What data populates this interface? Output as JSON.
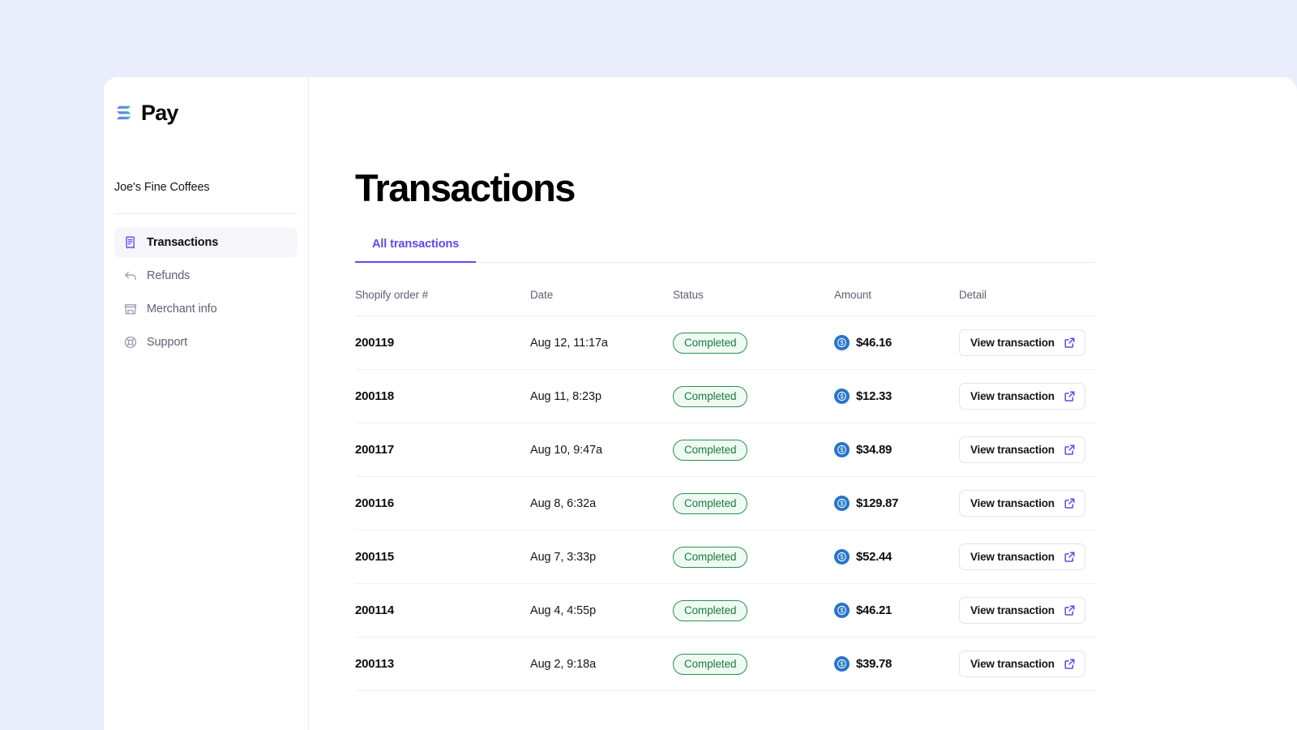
{
  "brand": {
    "logo_icon": "solana-bars-logo-icon",
    "name": "Pay",
    "gradient_from": "#19e0a8",
    "gradient_to": "#9945ff"
  },
  "sidebar": {
    "merchant_name": "Joe's Fine Coffees",
    "items": [
      {
        "label": "Transactions",
        "icon": "receipt-icon",
        "active": true
      },
      {
        "label": "Refunds",
        "icon": "arrow-return-icon",
        "active": false
      },
      {
        "label": "Merchant info",
        "icon": "storefront-icon",
        "active": false
      },
      {
        "label": "Support",
        "icon": "lifebuoy-icon",
        "active": false
      }
    ]
  },
  "main": {
    "page_title": "Transactions",
    "tabs": [
      {
        "label": "All transactions",
        "active": true
      }
    ],
    "table": {
      "columns": [
        "Shopify order #",
        "Date",
        "Status",
        "Amount",
        "Detail"
      ],
      "detail_button_label": "View transaction",
      "detail_button_icon": "external-link-icon",
      "currency_icon": "usdc-coin-icon",
      "rows": [
        {
          "order": "200119",
          "date": "Aug 12, 11:17a",
          "status": "Completed",
          "amount": "$46.16"
        },
        {
          "order": "200118",
          "date": "Aug 11, 8:23p",
          "status": "Completed",
          "amount": "$12.33"
        },
        {
          "order": "200117",
          "date": "Aug 10, 9:47a",
          "status": "Completed",
          "amount": "$34.89"
        },
        {
          "order": "200116",
          "date": "Aug 8, 6:32a",
          "status": "Completed",
          "amount": "$129.87"
        },
        {
          "order": "200115",
          "date": "Aug 7, 3:33p",
          "status": "Completed",
          "amount": "$52.44"
        },
        {
          "order": "200114",
          "date": "Aug 4, 4:55p",
          "status": "Completed",
          "amount": "$46.21"
        },
        {
          "order": "200113",
          "date": "Aug 2, 9:18a",
          "status": "Completed",
          "amount": "$39.78"
        }
      ]
    }
  },
  "colors": {
    "page_background": "#eaeefc",
    "accent": "#5b4bf0",
    "status_success_text": "#1d7a45",
    "status_success_bg": "#effaf2",
    "status_success_border": "#2f8f55",
    "usdc_blue": "#2775ca"
  }
}
